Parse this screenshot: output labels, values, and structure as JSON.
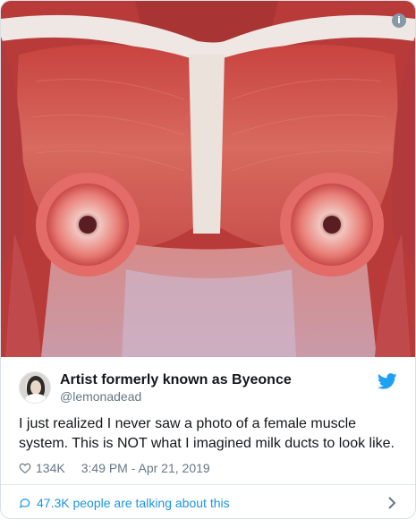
{
  "tweet": {
    "display_name": "Artist formerly known as Byeonce",
    "handle": "@lemonadead",
    "text": "I just realized I never saw a photo of a female muscle system. This is NOT what I imagined milk ducts to look like.",
    "likes": "134K",
    "timestamp": "3:49 PM - Apr 21, 2019",
    "talking_label": "47.3K people are talking about this"
  },
  "icons": {
    "info": "info-icon",
    "twitter": "twitter-bird-icon",
    "like": "heart-icon",
    "reply": "speech-bubble-icon",
    "more": "chevron-right-icon"
  },
  "colors": {
    "twitter_blue": "#1da1f2",
    "link_blue": "#1b95e0",
    "secondary_text": "#657786",
    "muscle_red": "#c9504c"
  }
}
